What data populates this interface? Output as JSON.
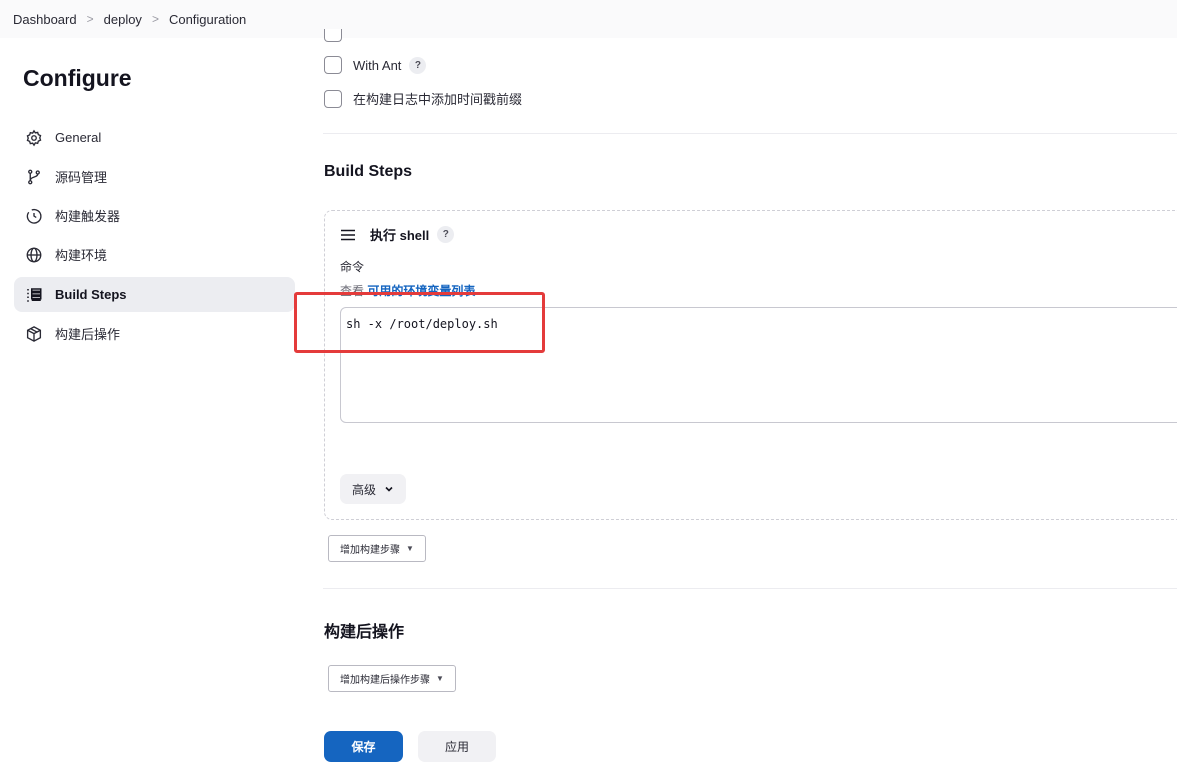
{
  "breadcrumb": {
    "items": [
      "Dashboard",
      "deploy",
      "Configuration"
    ],
    "separator": ">"
  },
  "sidebar": {
    "title": "Configure",
    "items": [
      {
        "label": "General",
        "icon": "gear-icon"
      },
      {
        "label": "源码管理",
        "icon": "branch-icon"
      },
      {
        "label": "构建触发器",
        "icon": "clock-icon"
      },
      {
        "label": "构建环境",
        "icon": "globe-icon"
      },
      {
        "label": "Build Steps",
        "icon": "list-icon",
        "active": true
      },
      {
        "label": "构建后操作",
        "icon": "cube-icon"
      }
    ]
  },
  "options": {
    "with_ant": "With Ant",
    "timestamp": "在构建日志中添加时间戳前缀",
    "help_glyph": "?"
  },
  "build_steps": {
    "title": "Build Steps",
    "step_title": "执行 shell",
    "command_label": "命令",
    "env_prefix": "查看",
    "env_link": "可用的环境变量列表",
    "command_value": "sh -x /root/deploy.sh",
    "advanced_label": "高级",
    "add_step_label": "增加构建步骤"
  },
  "post_build": {
    "title": "构建后操作",
    "add_label": "增加构建后操作步骤"
  },
  "footer": {
    "save_label": "保存",
    "apply_label": "应用"
  },
  "colors": {
    "primary": "#1565c0",
    "highlight": "#e43b3b",
    "active_bg": "#ecedf1"
  }
}
